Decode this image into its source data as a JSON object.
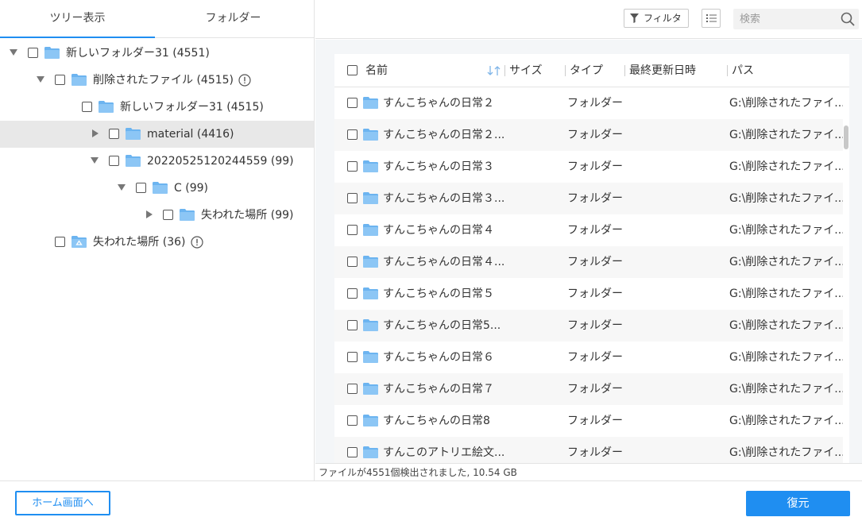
{
  "tabs": [
    {
      "label": "ツリー表示",
      "active": true
    },
    {
      "label": "フォルダー",
      "active": false
    }
  ],
  "tree": {
    "nodes": [
      {
        "label": "新しいフォルダー31 (4551)",
        "expanded": true,
        "info": false,
        "icon": "folder-icon"
      },
      {
        "label": "削除されたファイル (4515)",
        "expanded": true,
        "info": true,
        "icon": "folder-icon"
      },
      {
        "label": "新しいフォルダー31 (4515)",
        "expanded": null,
        "info": false,
        "icon": "folder-icon"
      },
      {
        "label": "material (4416)",
        "expanded": false,
        "info": false,
        "icon": "folder-icon",
        "selected": true
      },
      {
        "label": "20220525120244559 (99)",
        "expanded": true,
        "info": false,
        "icon": "folder-icon"
      },
      {
        "label": "C (99)",
        "expanded": true,
        "info": false,
        "icon": "folder-icon"
      },
      {
        "label": "失われた場所 (99)",
        "expanded": false,
        "info": false,
        "icon": "folder-icon"
      },
      {
        "label": "失われた場所 (36)",
        "expanded": null,
        "info": true,
        "icon": "recycle-folder-icon"
      }
    ]
  },
  "toolbar": {
    "filter_label": "フィルタ",
    "search_placeholder": "検索"
  },
  "table": {
    "headers": {
      "name": "名前",
      "size": "サイズ",
      "type": "タイプ",
      "modified": "最終更新日時",
      "path": "パス"
    },
    "rows": [
      {
        "name": "すんこちゃんの日常２",
        "type": "フォルダー",
        "path": "G:\\削除されたファイ..."
      },
      {
        "name": "すんこちゃんの日常２...",
        "type": "フォルダー",
        "path": "G:\\削除されたファイ..."
      },
      {
        "name": "すんこちゃんの日常３",
        "type": "フォルダー",
        "path": "G:\\削除されたファイ..."
      },
      {
        "name": "すんこちゃんの日常３...",
        "type": "フォルダー",
        "path": "G:\\削除されたファイ..."
      },
      {
        "name": "すんこちゃんの日常４",
        "type": "フォルダー",
        "path": "G:\\削除されたファイ..."
      },
      {
        "name": "すんこちゃんの日常４...",
        "type": "フォルダー",
        "path": "G:\\削除されたファイ..."
      },
      {
        "name": "すんこちゃんの日常５",
        "type": "フォルダー",
        "path": "G:\\削除されたファイ..."
      },
      {
        "name": "すんこちゃんの日常5...",
        "type": "フォルダー",
        "path": "G:\\削除されたファイ..."
      },
      {
        "name": "すんこちゃんの日常６",
        "type": "フォルダー",
        "path": "G:\\削除されたファイ..."
      },
      {
        "name": "すんこちゃんの日常７",
        "type": "フォルダー",
        "path": "G:\\削除されたファイ..."
      },
      {
        "name": "すんこちゃんの日常8",
        "type": "フォルダー",
        "path": "G:\\削除されたファイ..."
      },
      {
        "name": "すんこのアトリエ絵文...",
        "type": "フォルダー",
        "path": "G:\\削除されたファイ..."
      }
    ]
  },
  "status": {
    "text": "ファイルが4551個検出されました, 10.54 GB"
  },
  "footer": {
    "home_label": "ホーム画面へ",
    "restore_label": "復元"
  },
  "colors": {
    "accent": "#1f8ef1",
    "folder": "#6cb4f0"
  }
}
